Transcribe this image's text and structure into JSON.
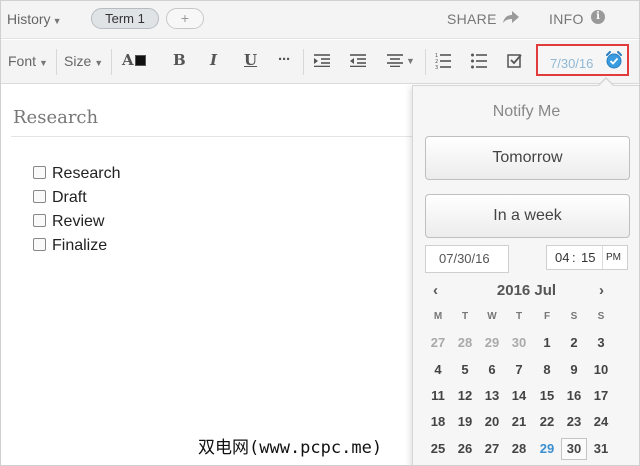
{
  "topbar": {
    "history_label": "History",
    "tabs": [
      "Term 1",
      "+"
    ],
    "share_label": "SHARE",
    "info_label": "INFO"
  },
  "toolbar": {
    "font_label": "Font",
    "size_label": "Size",
    "text_color_label": "A",
    "bold_label": "B",
    "italic_label": "I",
    "underline_label": "U",
    "more_label": "···",
    "reminder_date": "7/30/16"
  },
  "editor": {
    "title": "Research",
    "checklist": [
      "Research",
      "Draft",
      "Review",
      "Finalize"
    ]
  },
  "notify": {
    "title": "Notify Me",
    "tomorrow_label": "Tomorrow",
    "week_label": "In a week",
    "date_value": "07/30/16",
    "hour": "04",
    "minute": "15",
    "ampm": "PM",
    "calendar": {
      "title": "2016 Jul",
      "prev": "‹",
      "next": "›",
      "weekdays": [
        "M",
        "T",
        "W",
        "T",
        "F",
        "S",
        "S"
      ],
      "weeks": [
        [
          "27",
          "28",
          "29",
          "30",
          "1",
          "2",
          "3"
        ],
        [
          "4",
          "5",
          "6",
          "7",
          "8",
          "9",
          "10"
        ],
        [
          "11",
          "12",
          "13",
          "14",
          "15",
          "16",
          "17"
        ],
        [
          "18",
          "19",
          "20",
          "21",
          "22",
          "23",
          "24"
        ],
        [
          "25",
          "26",
          "27",
          "28",
          "29",
          "30",
          "31"
        ]
      ],
      "today": "29",
      "selected": "30"
    }
  },
  "watermark": "双电网(www.pcpc.me)",
  "colors": {
    "accent": "#3a8fd0",
    "highlight_border": "#e23b3b",
    "date_text": "#8fb8d6"
  }
}
